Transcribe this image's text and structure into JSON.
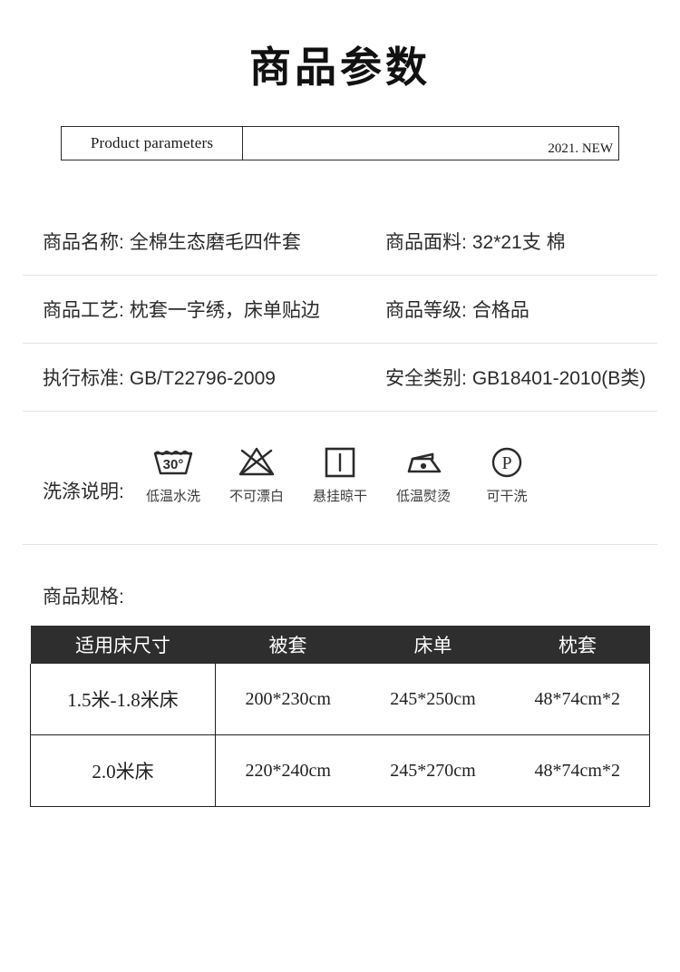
{
  "header": {
    "title": "商品参数",
    "subtitle_en": "Product parameters",
    "badge": "2021. NEW"
  },
  "parameters": [
    {
      "left_label": "商品名称:",
      "left_value": "全棉生态磨毛四件套",
      "right_label": "商品面料:",
      "right_value": "32*21支  棉"
    },
    {
      "left_label": "商品工艺:",
      "left_value": "枕套一字绣，床单贴边",
      "right_label": "商品等级:",
      "right_value": "合格品"
    },
    {
      "left_label": "执行标准:",
      "left_value": "GB/T22796-2009",
      "right_label": "安全类别:",
      "right_value": "GB18401-2010(B类)"
    }
  ],
  "wash": {
    "label": "洗涤说明:",
    "items": [
      {
        "icon": "wash-30-icon",
        "caption": "低温水洗"
      },
      {
        "icon": "no-bleach-icon",
        "caption": "不可漂白"
      },
      {
        "icon": "line-dry-icon",
        "caption": "悬挂晾干"
      },
      {
        "icon": "iron-low-icon",
        "caption": "低温熨烫"
      },
      {
        "icon": "dry-clean-p-icon",
        "caption": "可干洗"
      }
    ]
  },
  "spec": {
    "title": "商品规格:",
    "columns": [
      "适用床尺寸",
      "被套",
      "床单",
      "枕套"
    ],
    "rows": [
      [
        "1.5米-1.8米床",
        "200*230cm",
        "245*250cm",
        "48*74cm*2"
      ],
      [
        "2.0米床",
        "220*240cm",
        "245*270cm",
        "48*74cm*2"
      ]
    ]
  },
  "colors": {
    "table_header_bg": "#2e2e2e",
    "divider": "#e2e2e2",
    "text": "#2b2b2b"
  }
}
